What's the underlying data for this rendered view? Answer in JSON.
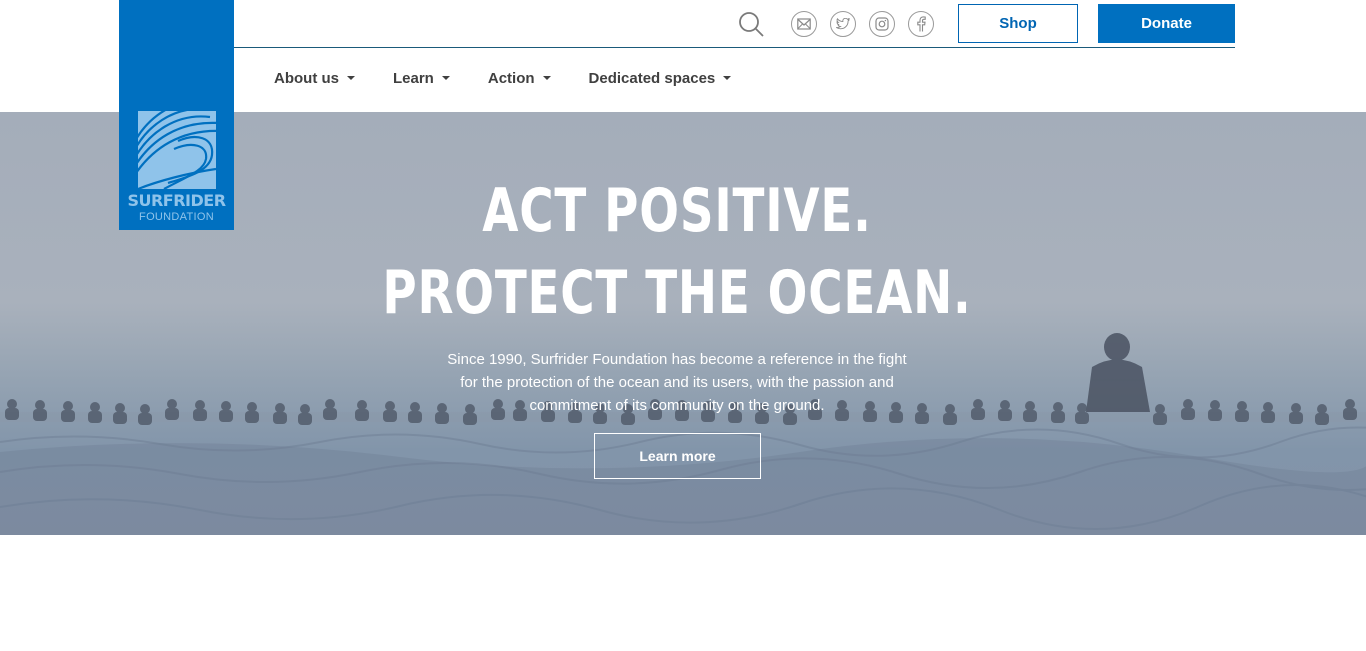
{
  "brand": {
    "name": "SURFRIDER",
    "subname": "FOUNDATION",
    "color": "#0070c0"
  },
  "topbar": {
    "search_icon": "search-icon",
    "social": [
      {
        "name": "email",
        "icon": "envelope-icon"
      },
      {
        "name": "twitter",
        "icon": "twitter-icon"
      },
      {
        "name": "instagram",
        "icon": "instagram-icon"
      },
      {
        "name": "facebook",
        "icon": "facebook-icon"
      }
    ],
    "shop_label": "Shop",
    "donate_label": "Donate"
  },
  "nav": {
    "items": [
      {
        "label": "About us"
      },
      {
        "label": "Learn"
      },
      {
        "label": "Action"
      },
      {
        "label": "Dedicated spaces"
      }
    ]
  },
  "hero": {
    "title_line1": "ACT POSITIVE.",
    "title_line2": "PROTECT THE OCEAN.",
    "text": "Since 1990, Surfrider Foundation has become a reference in the fight for the protection of the ocean and its users, with the passion and commitment of its community on the ground.",
    "cta_label": "Learn more"
  },
  "colors": {
    "accent": "#0070c0",
    "nav_text": "#404040",
    "divider": "#1a5a7a"
  }
}
